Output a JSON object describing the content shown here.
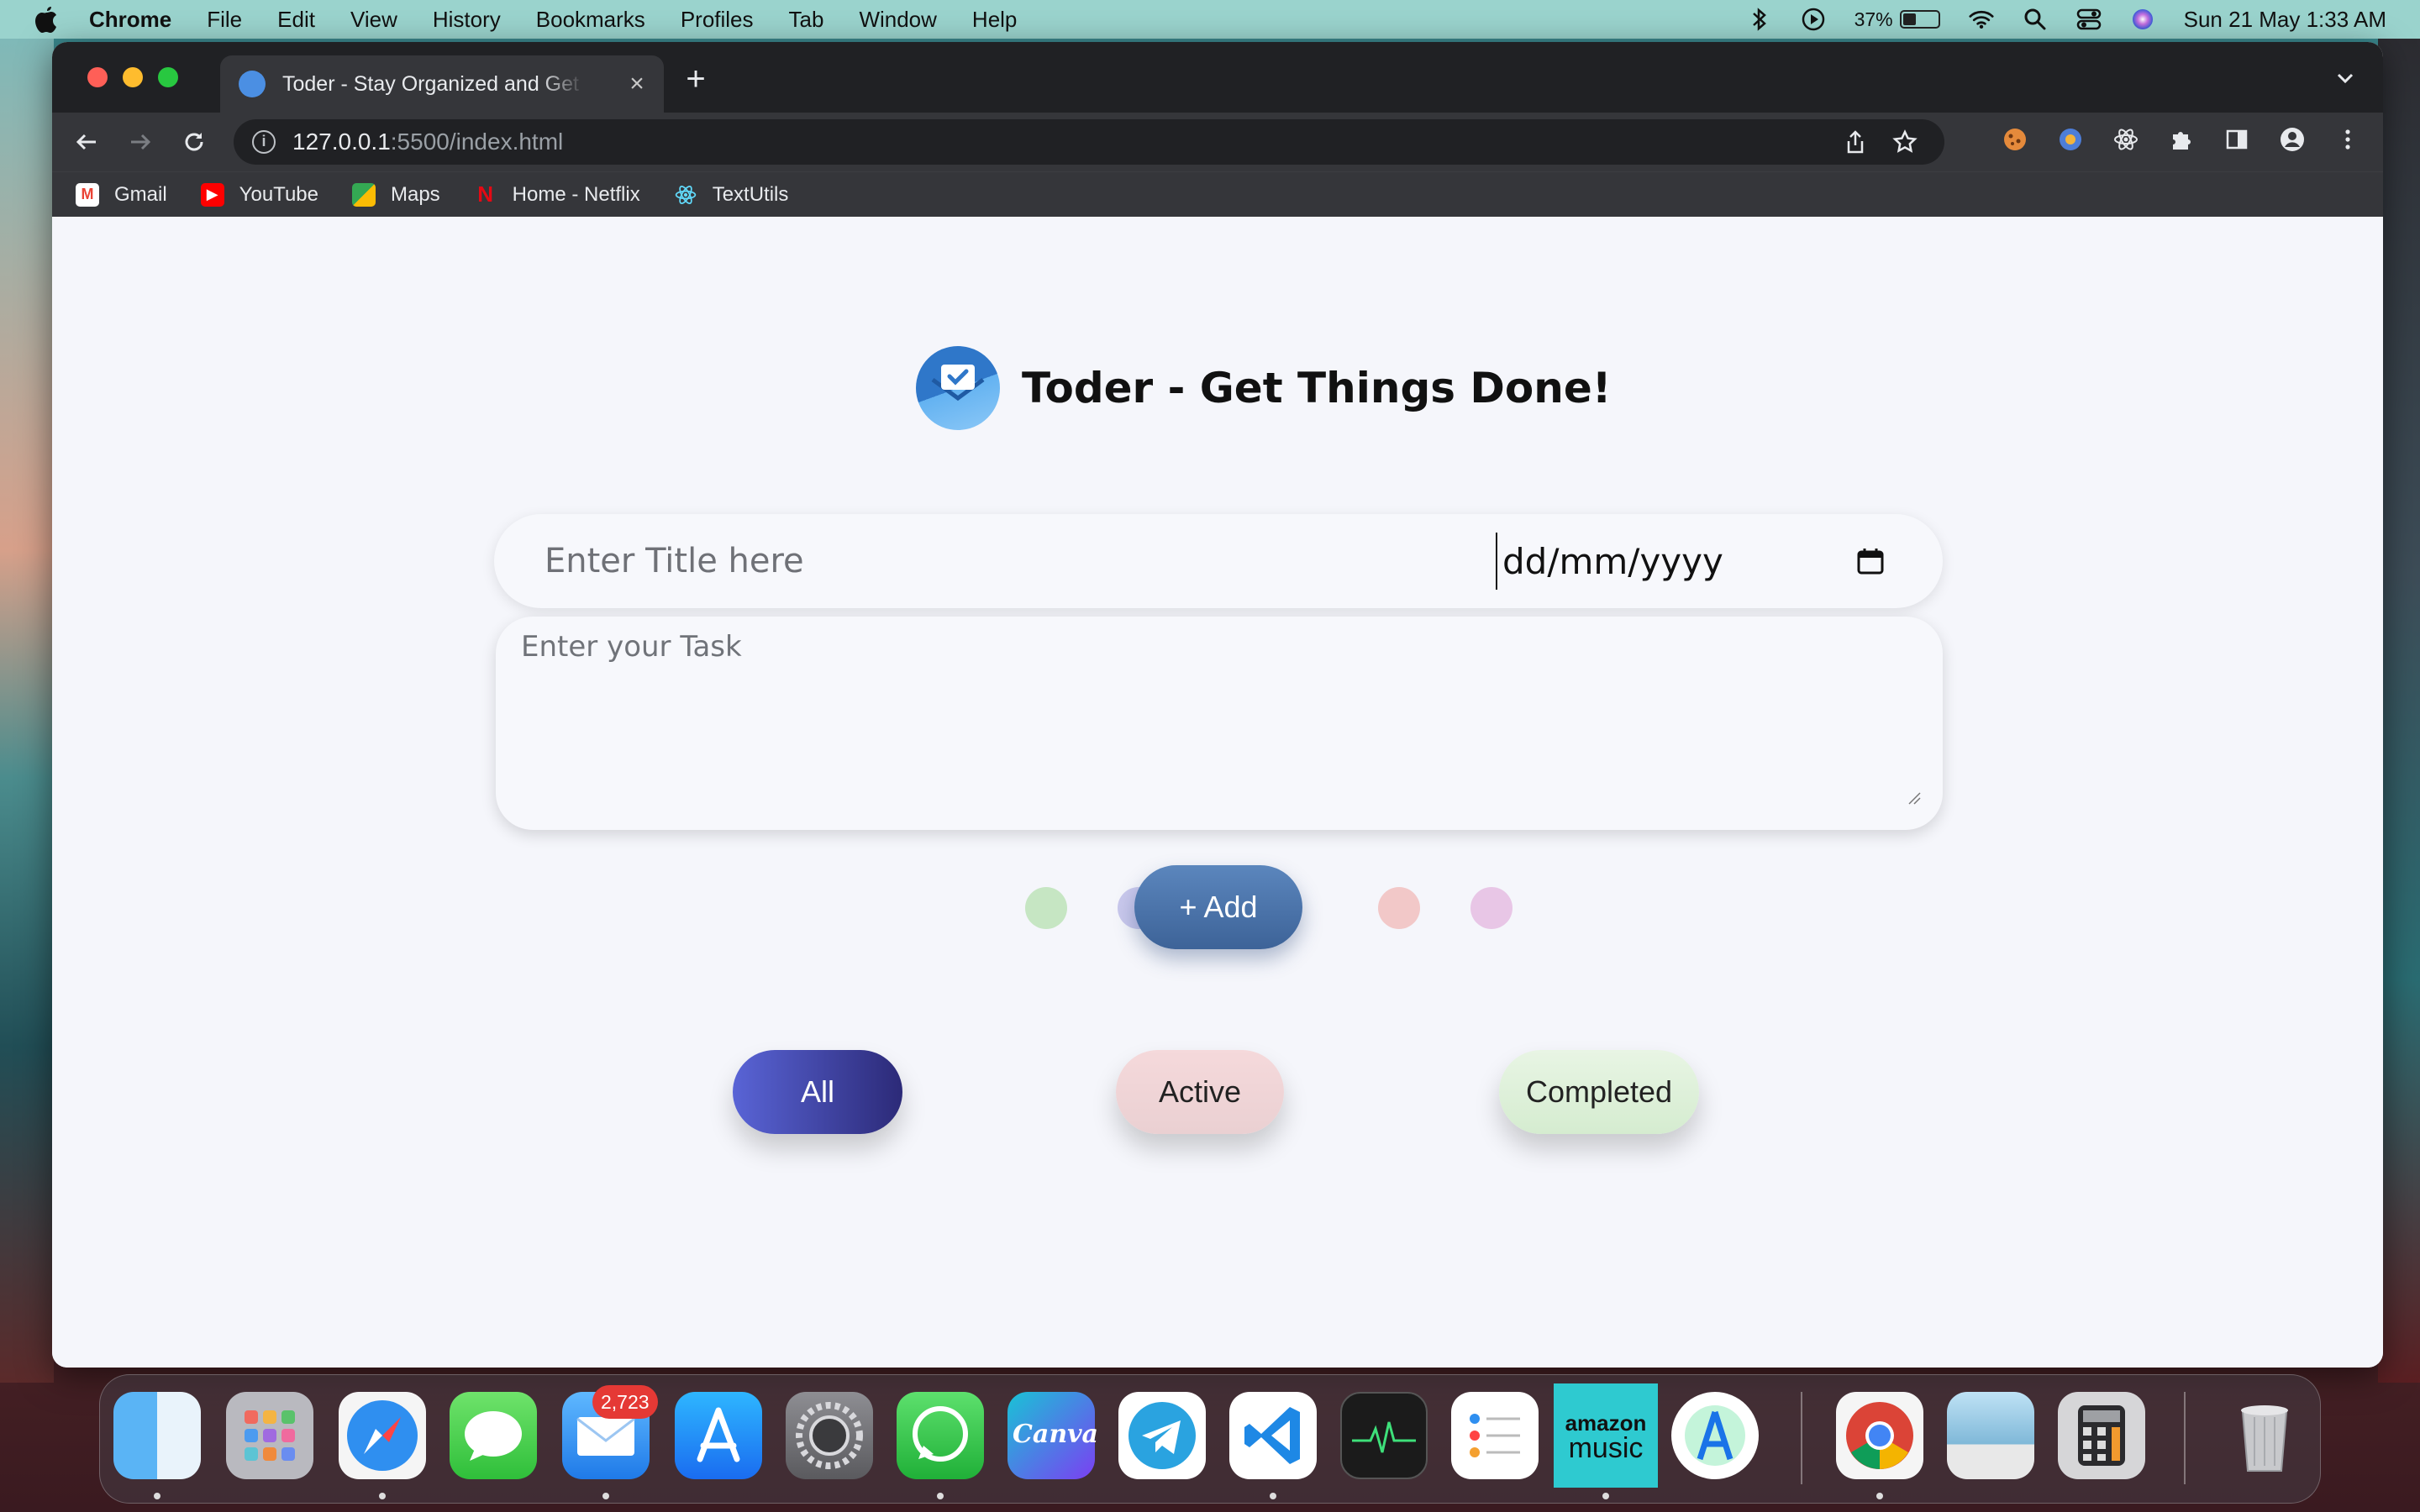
{
  "menubar": {
    "app_name": "Chrome",
    "items": [
      "File",
      "Edit",
      "View",
      "History",
      "Bookmarks",
      "Profiles",
      "Tab",
      "Window",
      "Help"
    ],
    "battery_percent": "37%",
    "battery_level": 0.37,
    "datetime": "Sun 21 May  1:33 AM"
  },
  "browser": {
    "tab_title": "Toder - Stay Organized and Get Things Done",
    "url_host": "127.0.0.1",
    "url_path": ":5500/index.html",
    "bookmarks": [
      {
        "label": "Gmail",
        "color": "#ea4335"
      },
      {
        "label": "YouTube",
        "color": "#ff0000"
      },
      {
        "label": "Maps",
        "color": "#34a853"
      },
      {
        "label": "Home - Netflix",
        "color": "#e50914"
      },
      {
        "label": "TextUtils",
        "color": "#61dafb"
      }
    ]
  },
  "app": {
    "heading": "Toder - Get Things Done!",
    "title_placeholder": "Enter Title here",
    "date_placeholder": "dd/mm/yyyy",
    "task_placeholder": "Enter your Task",
    "add_label": "+ Add",
    "colors": [
      "#c6e6c3",
      "#c9c8ec",
      "#f2c8c8",
      "#e8c6e6"
    ],
    "filters": {
      "all": "All",
      "active": "Active",
      "completed": "Completed"
    }
  },
  "dock": {
    "mail_badge": "2,723",
    "amazon_music_line1": "amazon",
    "amazon_music_line2": "music",
    "canva_label": "Canva"
  }
}
